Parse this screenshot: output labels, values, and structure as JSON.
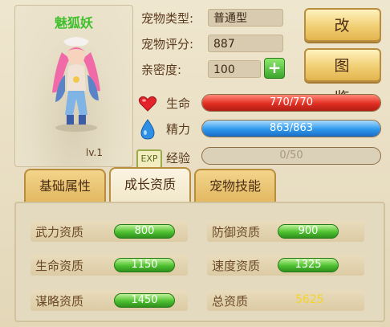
{
  "pet": {
    "name": "魅狐妖",
    "level": "lv.1",
    "type_label": "宠物类型:",
    "type_value": "普通型",
    "score_label": "宠物评分:",
    "score_value": "887",
    "intimacy_label": "亲密度:",
    "intimacy_value": "100",
    "plus_icon": "+"
  },
  "buttons": {
    "rename": "改 名",
    "handbook": "图 鉴"
  },
  "bars": {
    "hp_label": "生命",
    "hp_text": "770/770",
    "hp_current": 770,
    "hp_max": 770,
    "mp_label": "精力",
    "mp_text": "863/863",
    "mp_current": 863,
    "mp_max": 863,
    "exp_badge": "EXP",
    "exp_label": "经验",
    "exp_text": "0/50",
    "exp_current": 0,
    "exp_max": 50
  },
  "tabs": [
    {
      "label": "基础属性",
      "active": false
    },
    {
      "label": "成长资质",
      "active": true
    },
    {
      "label": "宠物技能",
      "active": false
    }
  ],
  "stats": {
    "left": [
      {
        "name": "武力资质",
        "value": "800"
      },
      {
        "name": "生命资质",
        "value": "1150"
      },
      {
        "name": "谋略资质",
        "value": "1450"
      }
    ],
    "right": [
      {
        "name": "防御资质",
        "value": "900"
      },
      {
        "name": "速度资质",
        "value": "1325"
      }
    ],
    "total_name": "总资质",
    "total_value": "5625"
  },
  "colors": {
    "hp": "#e22e22",
    "mp": "#2d98ec",
    "pill": "#4dc12f",
    "pet_name": "#3fbf2c",
    "total": "#f4d329"
  }
}
